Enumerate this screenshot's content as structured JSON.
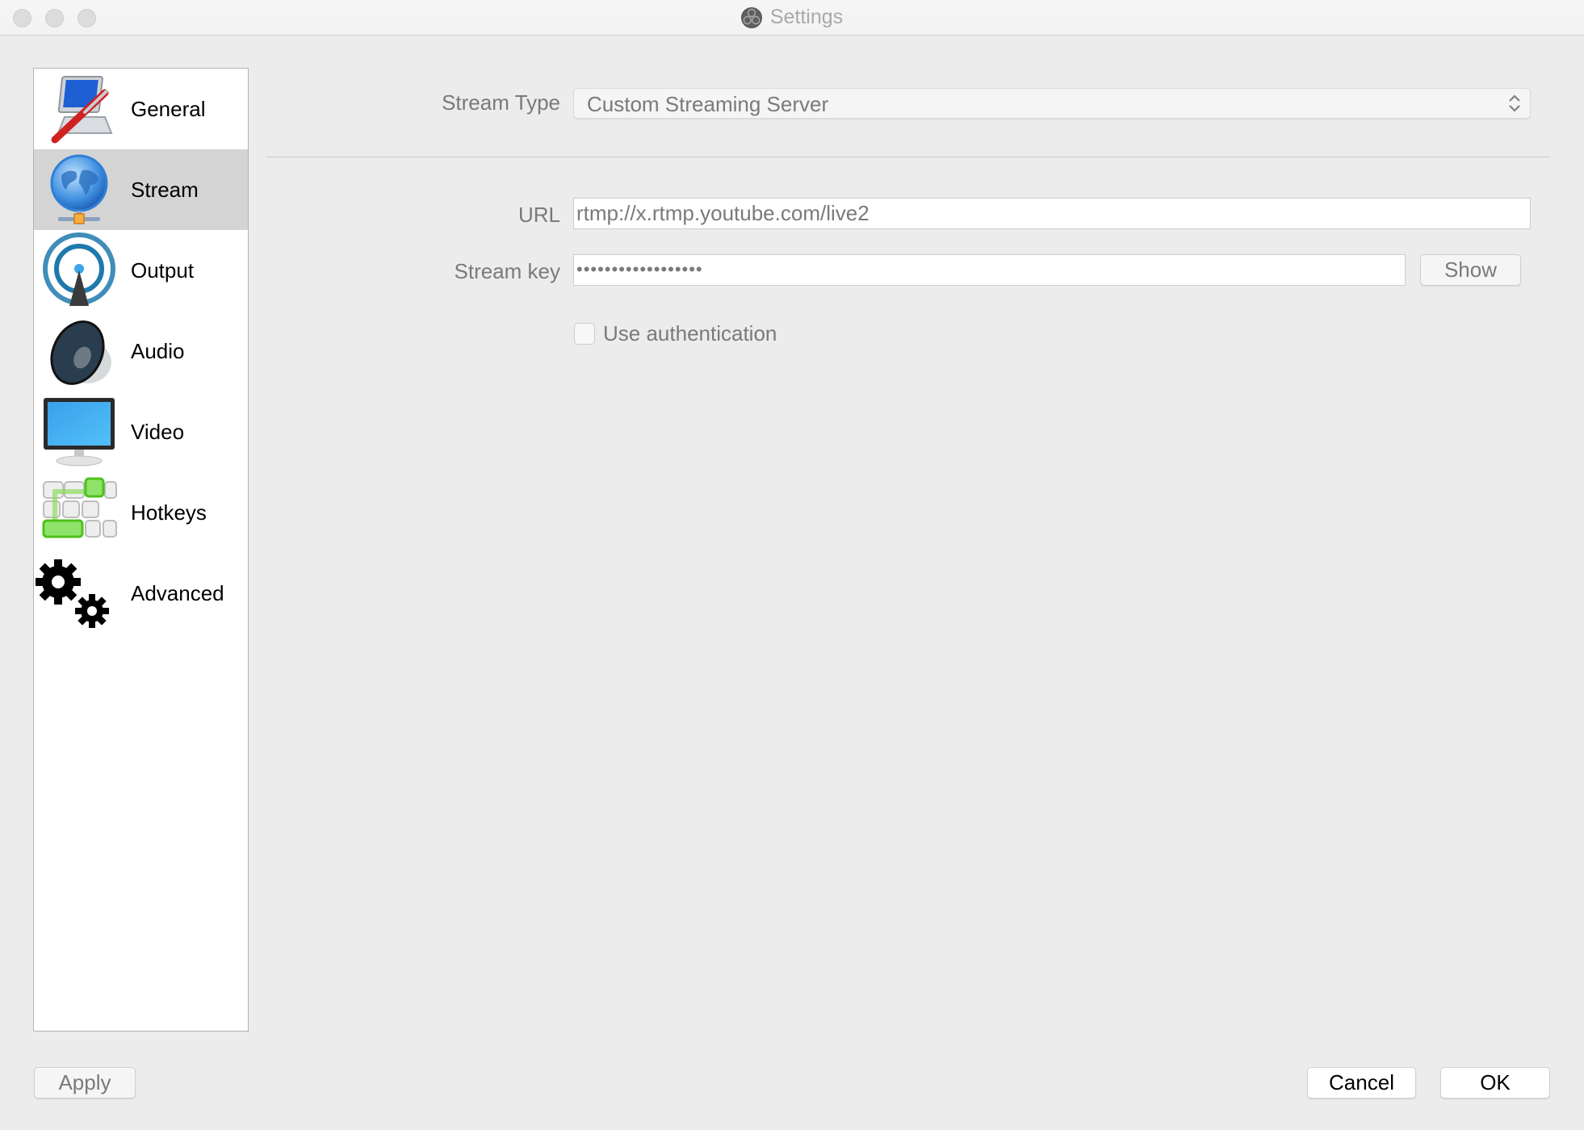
{
  "window": {
    "title": "Settings",
    "title_icon": "obs-logo-icon"
  },
  "sidebar": {
    "items": [
      {
        "label": "General",
        "icon": "general-icon",
        "selected": false
      },
      {
        "label": "Stream",
        "icon": "globe-network-icon",
        "selected": true
      },
      {
        "label": "Output",
        "icon": "antenna-broadcast-icon",
        "selected": false
      },
      {
        "label": "Audio",
        "icon": "speaker-icon",
        "selected": false
      },
      {
        "label": "Video",
        "icon": "monitor-icon",
        "selected": false
      },
      {
        "label": "Hotkeys",
        "icon": "keyboard-keys-icon",
        "selected": false
      },
      {
        "label": "Advanced",
        "icon": "gears-icon",
        "selected": false
      }
    ]
  },
  "stream": {
    "stream_type_label": "Stream Type",
    "stream_type_value": "Custom Streaming Server",
    "url_label": "URL",
    "url_value": "rtmp://x.rtmp.youtube.com/live2",
    "stream_key_label": "Stream key",
    "stream_key_value": "••••••••••••••••••",
    "show_button": "Show",
    "use_auth_label": "Use authentication",
    "use_auth_checked": false
  },
  "footer": {
    "apply": "Apply",
    "cancel": "Cancel",
    "ok": "OK"
  },
  "colors": {
    "window_bg": "#ececec",
    "selected_item_bg": "#d4d4d4",
    "label_gray": "#7a7a7a"
  }
}
